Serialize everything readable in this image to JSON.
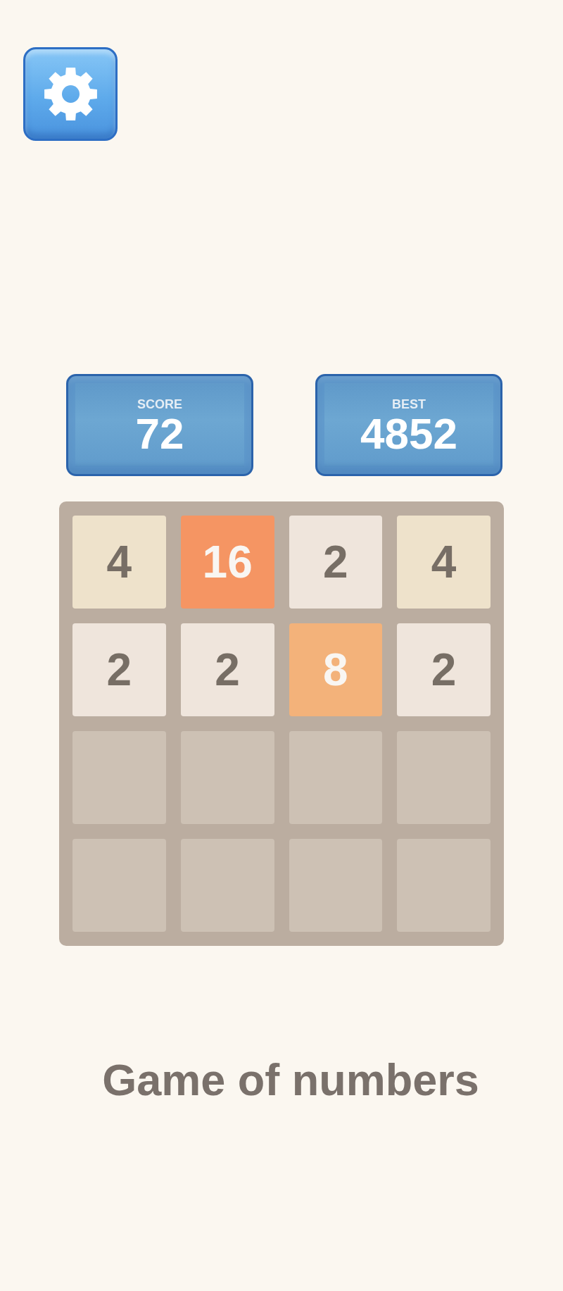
{
  "scores": [
    {
      "label": "SCORE",
      "value": "72"
    },
    {
      "label": "BEST",
      "value": "4852"
    }
  ],
  "board": {
    "rows": [
      [
        {
          "kind": "pale",
          "value": "4",
          "color": "#eee2cb"
        },
        {
          "kind": "warm",
          "value": "16",
          "color": "#f59563"
        },
        {
          "kind": "pale",
          "value": "2",
          "color": "#efe5dc"
        },
        {
          "kind": "pale",
          "value": "4",
          "color": "#eee2cb"
        }
      ],
      [
        {
          "kind": "pale",
          "value": "2",
          "color": "#efe5dc"
        },
        {
          "kind": "pale",
          "value": "2",
          "color": "#efe5dc"
        },
        {
          "kind": "warm",
          "value": "8",
          "color": "#f3b27a"
        },
        {
          "kind": "pale",
          "value": "2",
          "color": "#efe5dc"
        }
      ],
      [
        {
          "kind": "empty"
        },
        {
          "kind": "empty"
        },
        {
          "kind": "empty"
        },
        {
          "kind": "empty"
        }
      ],
      [
        {
          "kind": "empty"
        },
        {
          "kind": "empty"
        },
        {
          "kind": "empty"
        },
        {
          "kind": "empty"
        }
      ]
    ]
  },
  "title": "Game of numbers"
}
